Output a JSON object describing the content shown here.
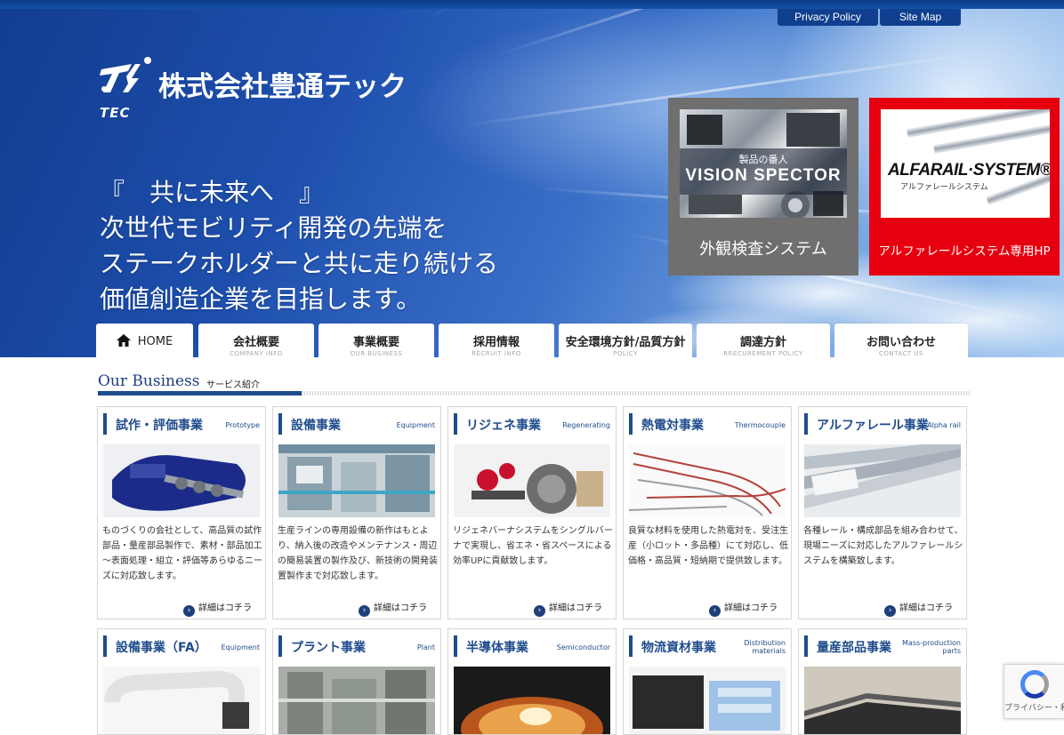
{
  "header": {
    "top_links": [
      "Privacy Policy",
      "Site Map"
    ],
    "logo_name": "株式会社豊通テック",
    "logo_sub": "TEC"
  },
  "hero": {
    "tagline": [
      "『　共に未来へ　』",
      "次世代モビリティ開発の先端を",
      "ステークホルダーと共に走り続ける",
      "価値創造企業を目指します。"
    ]
  },
  "promos": {
    "vision": {
      "label": "外観検査システム",
      "image_small": "製品の番人",
      "image_big": "VISION SPECTOR"
    },
    "alfa": {
      "label": "アルファレールシステム専用HP",
      "image_logo": "ALFARAIL·SYSTEM®",
      "image_sub": "アルファレールシステム"
    }
  },
  "nav": [
    {
      "jp": "HOME",
      "en": ""
    },
    {
      "jp": "会社概要",
      "en": "COMPANY INFO"
    },
    {
      "jp": "事業概要",
      "en": "OUR BUSINESS"
    },
    {
      "jp": "採用情報",
      "en": "RECRUIT INFO"
    },
    {
      "jp": "安全環境方針/品質方針",
      "en": "POLICY"
    },
    {
      "jp": "調達方針",
      "en": "RRECUREMENT POLICY"
    },
    {
      "jp": "お問い合わせ",
      "en": "CONTACT US"
    }
  ],
  "section": {
    "title": "Our Business",
    "subtitle": "サービス紹介"
  },
  "more_label": "詳細はコチラ",
  "cards": [
    {
      "title": "試作・評価事業",
      "en": "Prototype",
      "text": "ものづくりの会社として、高品質の試作部品・量産部品製作で、素材・部品加工～表面処理・組立・評価等あらゆるニーズに対応致します。"
    },
    {
      "title": "設備事業",
      "en": "Equipment",
      "text": "生産ラインの専用設備の新作はもとより、納入後の改造やメンテナンス・周辺の簡易装置の製作及び、新技術の開発装置製作まで対応致します。"
    },
    {
      "title": "リジェネ事業",
      "en": "Regenerating",
      "text": "リジェネバーナシステムをシングルバーナで実現し、省エネ・省スペースによる効率UPに貢献致します。"
    },
    {
      "title": "熱電対事業",
      "en": "Thermocouple",
      "text": "良質な材料を使用した熱電対を、受注生産（小ロット・多品種）にて対応し、低価格・高品質・短納期で提供致します。"
    },
    {
      "title": "アルファレール事業",
      "en": "Alpha rail",
      "text": "各種レール・構成部品を組み合わせて、現場ニーズに対応したアルファレールシステムを構築致します。"
    },
    {
      "title": "設備事業（FA）",
      "en": "Equipment",
      "text": ""
    },
    {
      "title": "プラント事業",
      "en": "Plant",
      "text": ""
    },
    {
      "title": "半導体事業",
      "en": "Semiconductor",
      "text": ""
    },
    {
      "title": "物流資材事業",
      "en": "Distribution materials",
      "text": ""
    },
    {
      "title": "量産部品事業",
      "en": "Mass-production parts",
      "text": ""
    }
  ],
  "recaptcha": {
    "text": "プライバシー・利用規約"
  },
  "colors": {
    "brand_blue": "#1f4c8c",
    "alfa_red": "#e6000f",
    "vision_gray": "#6f6f6f"
  }
}
